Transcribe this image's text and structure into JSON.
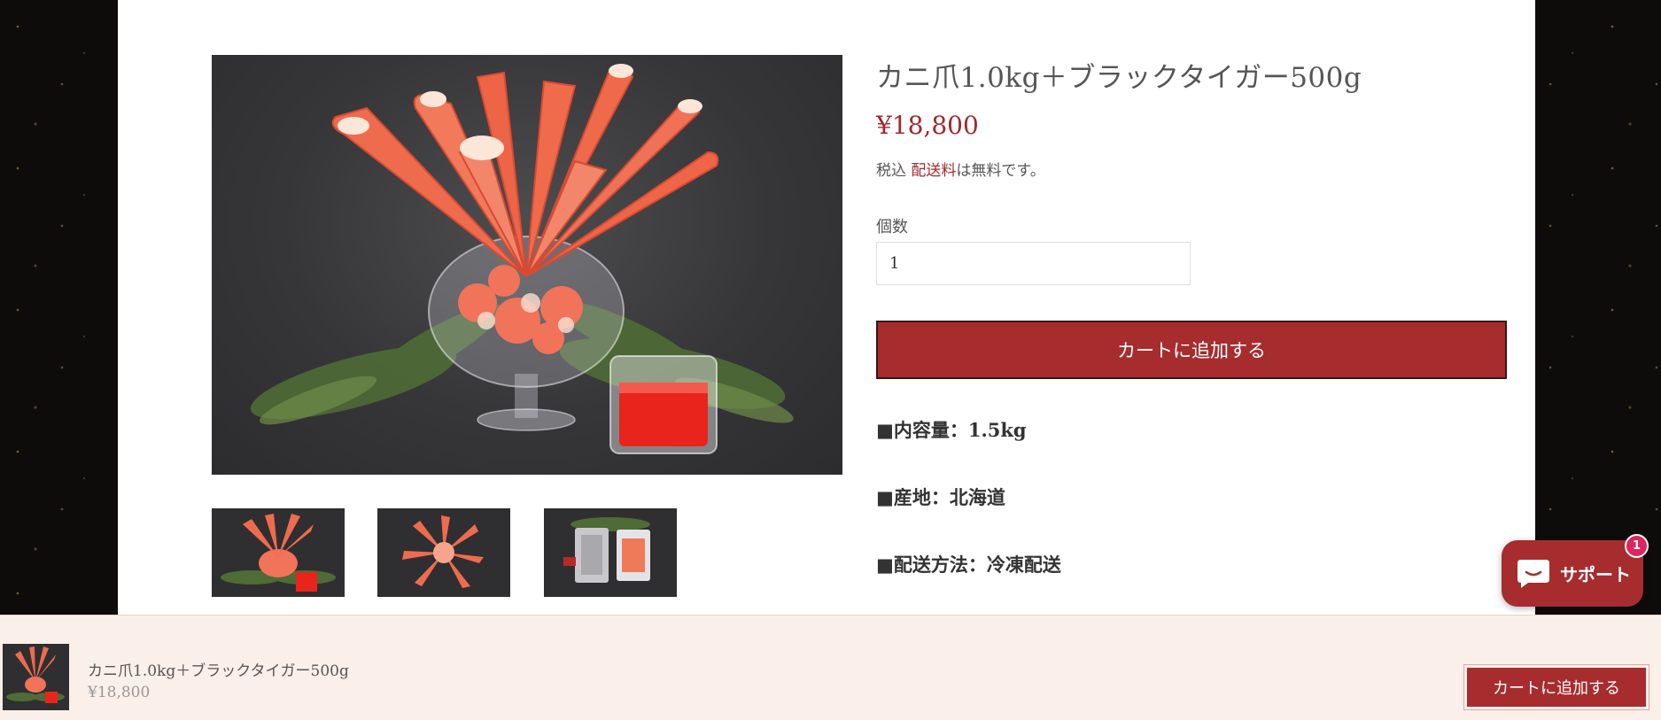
{
  "product": {
    "title": "カニ爪1.0kg＋ブラックタイガー500g",
    "price": "¥18,800",
    "tax_prefix": "税込 ",
    "shipping_link": "配送料",
    "shipping_suffix": "は無料です。",
    "qty_label": "個数",
    "qty_value": "1",
    "add_to_cart": "カートに追加する",
    "specs": [
      "■内容量：1.5kg",
      "■産地：北海道",
      "■配送方法：冷凍配送"
    ]
  },
  "gallery": {
    "main_image": "crab-claw-glass-photo",
    "thumbnails": [
      "crab-claw-glass-thumb",
      "crab-claw-plate-thumb",
      "packaged-seafood-thumb"
    ]
  },
  "sticky_bar": {
    "title": "カニ爪1.0kg＋ブラックタイガー500g",
    "price": "¥18,800",
    "add_to_cart": "カートに追加する"
  },
  "support_chat": {
    "label": "サポート",
    "badge_count": "1",
    "icon": "chat-bubble-icon"
  },
  "colors": {
    "accent": "#a72c2e",
    "price": "#9d2a2e",
    "sticky_bg": "#fbefe9",
    "badge": "#e0245e"
  }
}
